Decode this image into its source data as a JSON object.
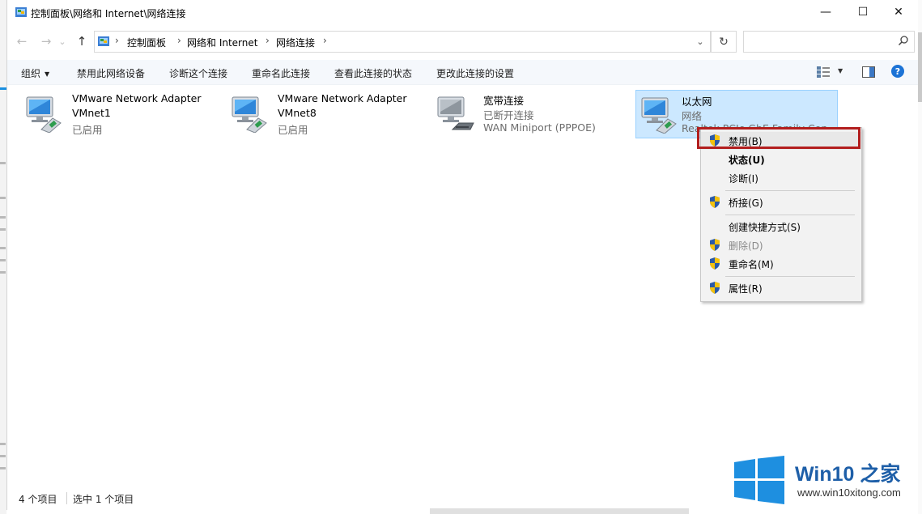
{
  "window": {
    "title": "控制面板\\网络和 Internet\\网络连接",
    "minimize_glyph": "—",
    "maximize_glyph": "☐",
    "close_glyph": "✕"
  },
  "nav": {
    "back_glyph": "←",
    "forward_glyph": "→",
    "recent_glyph": "⌄",
    "up_glyph": "↑",
    "refresh_glyph": "↻",
    "dropdown_glyph": "⌄"
  },
  "address": {
    "crumbs": [
      "控制面板",
      "网络和 Internet",
      "网络连接"
    ],
    "separator": "›"
  },
  "search": {
    "placeholder": "",
    "value": ""
  },
  "commands": {
    "organize": "组织",
    "disable_device": "禁用此网络设备",
    "diagnose": "诊断这个连接",
    "rename": "重命名此连接",
    "view_status": "查看此连接的状态",
    "change_settings": "更改此连接的设置",
    "help_glyph": "?"
  },
  "items": [
    {
      "name": "VMware Network Adapter VMnet1",
      "name_line1": "VMware Network Adapter",
      "name_line2": "VMnet1",
      "status": "已启用",
      "device": ""
    },
    {
      "name": "VMware Network Adapter VMnet8",
      "name_line1": "VMware Network Adapter",
      "name_line2": "VMnet8",
      "status": "已启用",
      "device": ""
    },
    {
      "name": "宽带连接",
      "status": "已断开连接",
      "device": "WAN Miniport (PPPOE)"
    },
    {
      "name": "以太网",
      "status": "网络",
      "device": "Realtek PCIe GbE Family Cont"
    }
  ],
  "context_menu": [
    {
      "label": "禁用(B)",
      "shield": true
    },
    {
      "label": "状态(U)",
      "bold": true
    },
    {
      "label": "诊断(I)"
    },
    {
      "label": "桥接(G)",
      "shield": true
    },
    {
      "label": "创建快捷方式(S)"
    },
    {
      "label": "删除(D)",
      "shield": true,
      "disabled": true
    },
    {
      "label": "重命名(M)",
      "shield": true
    },
    {
      "label": "属性(R)",
      "shield": true
    }
  ],
  "statusbar": {
    "item_count": "4 个项目",
    "selected_count": "选中 1 个项目"
  },
  "watermark": {
    "title": "Win10 之家",
    "url": "www.win10xitong.com"
  },
  "colors": {
    "accent": "#1c73d6",
    "selection": "#cce8ff",
    "highlight_box": "#b21e1e"
  }
}
